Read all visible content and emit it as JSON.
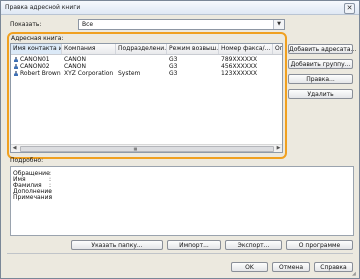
{
  "window": {
    "title": "Правка адресной книги",
    "close_glyph": "✕"
  },
  "filter": {
    "label": "Показать:",
    "value": "Все",
    "arrow_glyph": "▼"
  },
  "address_book": {
    "label": "Адресная книга:",
    "columns": [
      "Имя контакта или...",
      "Компания",
      "Подразделени...",
      "Режим возвыш...",
      "Номер факса/...",
      "Опи"
    ],
    "rows": [
      {
        "name": "CANON01",
        "company": "CANON",
        "dept": "",
        "mode": "G3",
        "fax": "789XXXXXX"
      },
      {
        "name": "CANON02",
        "company": "CANON",
        "dept": "",
        "mode": "G3",
        "fax": "456XXXXXX"
      },
      {
        "name": "Robert Brown",
        "company": "XYZ Corporation",
        "dept": "System",
        "mode": "G3",
        "fax": "123XXXXXX"
      }
    ],
    "scroll_left_glyph": "◀",
    "scroll_right_glyph": "▶",
    "scroll_grip_glyph": "▦"
  },
  "side_buttons": {
    "add_address": "Добавить адресата...",
    "add_group": "Добавить группу...",
    "edit": "Правка...",
    "delete": "Удалить"
  },
  "details": {
    "label": "Подробно:",
    "fields": [
      {
        "label": "Обращение",
        "value": ":"
      },
      {
        "label": "Имя",
        "value": ":"
      },
      {
        "label": "Фамилия",
        "value": ":"
      },
      {
        "label": "Дополнение",
        "value": ":"
      },
      {
        "label": "Примечания",
        "value": ":"
      }
    ]
  },
  "action_buttons": {
    "specify_folder": "Указать папку...",
    "import": "Импорт...",
    "export": "Экспорт...",
    "about": "О программе"
  },
  "dialog_buttons": {
    "ok": "OK",
    "cancel": "Отмена",
    "help": "Справка"
  },
  "colors": {
    "highlight": "#f0a020",
    "title_gradient_top": "#f6f9fd",
    "person_icon": "#3d6fb4"
  },
  "icons": {
    "contact": "person-icon"
  }
}
